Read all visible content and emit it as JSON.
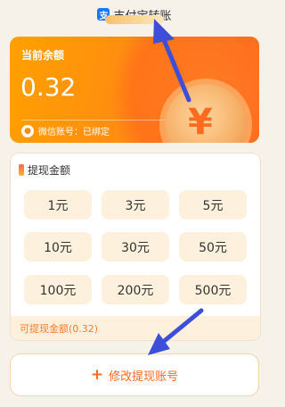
{
  "header": {
    "title": "支付宝转账",
    "icon": "alipay-icon"
  },
  "balance": {
    "label": "当前余额",
    "value": "0.32",
    "wechat_text": "微信账号：已绑定",
    "coin_symbol": "¥"
  },
  "amounts": {
    "title": "提现金额",
    "options": [
      "1元",
      "3元",
      "5元",
      "10元",
      "30元",
      "50元",
      "100元",
      "200元",
      "500元"
    ],
    "available_text": "可提现金额(0.32)"
  },
  "modify": {
    "label": "修改提现账号"
  },
  "colors": {
    "accent": "#ff8a14",
    "arrow": "#3d4fd8",
    "soft": "#fdf1de"
  }
}
